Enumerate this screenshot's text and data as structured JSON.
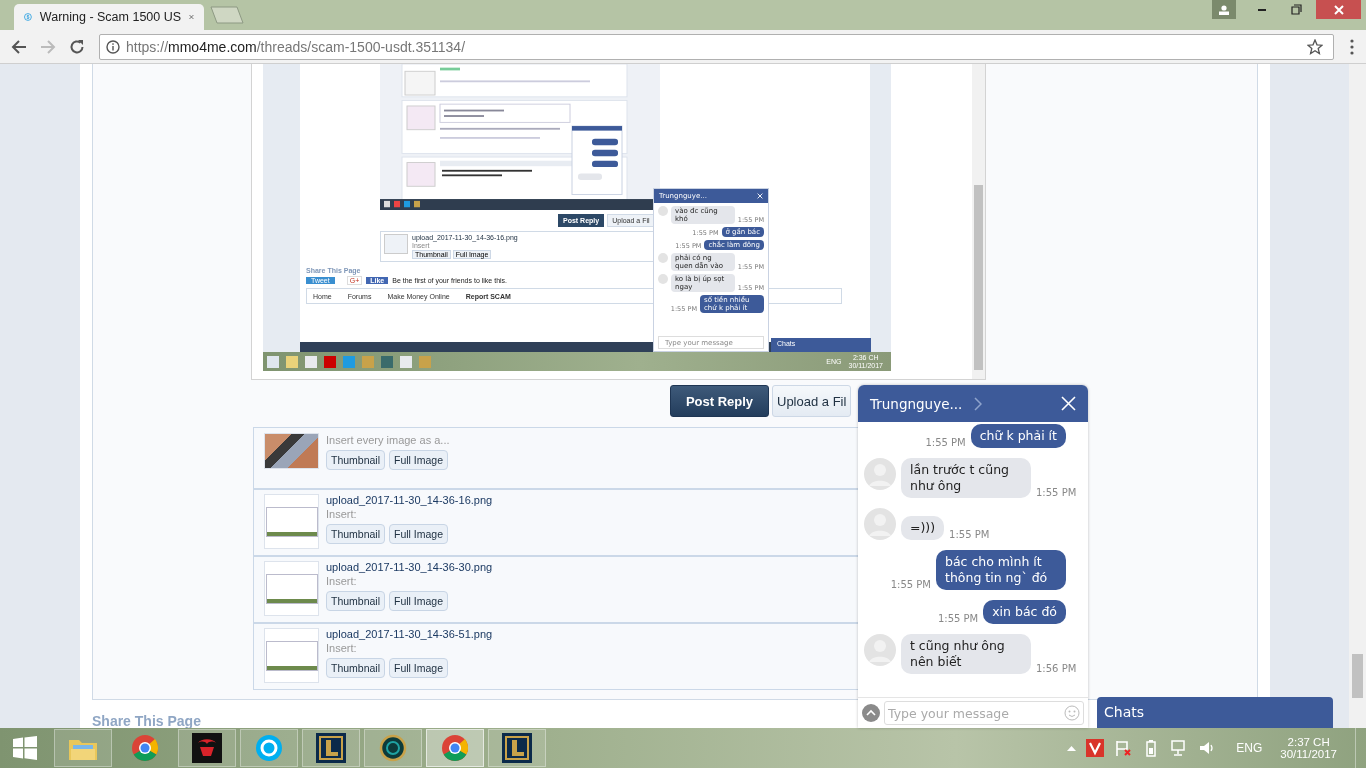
{
  "browser": {
    "tab_title": "Warning - Scam 1500 US",
    "url": "https://mmo4me.com/threads/scam-1500-usdt.351134/"
  },
  "embedded_screenshot": {
    "buttons": [
      "Post Reply",
      "Upload a Fil"
    ],
    "upload": {
      "filename": "upload_2017-11-30_14-36-16.png",
      "insert_label": "Insert",
      "buttons": [
        "Thumbnail",
        "Full Image"
      ]
    },
    "share_title": "Share This Page",
    "tweet": "Tweet",
    "gplus": "G+",
    "like": "Like",
    "like_text": "Be the first of your friends to like this.",
    "breadcrumbs": [
      "Home",
      "Forums",
      "Make Money Online",
      "Report SCAM"
    ],
    "chat": {
      "title": "Trungnguye...",
      "placeholder": "Type your message",
      "messages": [
        {
          "kind": "incoming",
          "text": "vào đc cũng khó",
          "time": "1:55 PM"
        },
        {
          "kind": "outgoing",
          "text": "ở gần bác",
          "time": "1:55 PM"
        },
        {
          "kind": "outgoing",
          "text": "chắc làm đông",
          "time": "1:55 PM"
        },
        {
          "kind": "incoming",
          "text": "phải có ng quen dẫn vào",
          "time": "1:55 PM"
        },
        {
          "kind": "incoming",
          "text": "ko là bị úp sọt ngay",
          "time": "1:55 PM"
        },
        {
          "kind": "outgoing",
          "text": "số tiền nhiều chứ k phải ít",
          "time": "1:55 PM"
        }
      ]
    },
    "chats_label": "Chats",
    "taskbar": {
      "language": "ENG",
      "time": "2:36 CH",
      "date": "30/11/2017"
    }
  },
  "reply_buttons": [
    "Post Reply",
    "Upload a Fil"
  ],
  "attachments": {
    "insert_all": "Insert every image as a...",
    "buttons": [
      "Thumbnail",
      "Full Image"
    ],
    "files": [
      {
        "name": "upload_2017-11-30_14-36-16.png",
        "insert_label": "Insert:",
        "buttons": [
          "Thumbnail",
          "Full Image"
        ]
      },
      {
        "name": "upload_2017-11-30_14-36-30.png",
        "insert_label": "Insert:",
        "buttons": [
          "Thumbnail",
          "Full Image"
        ]
      },
      {
        "name": "upload_2017-11-30_14-36-51.png",
        "insert_label": "Insert:",
        "buttons": [
          "Thumbnail",
          "Full Image"
        ]
      }
    ]
  },
  "share_title": "Share This Page",
  "chat": {
    "title": "Trungnguye...",
    "placeholder": "Type your message",
    "messages": [
      {
        "kind": "outgoing",
        "text": "chữ k phải ít",
        "time": "1:55 PM"
      },
      {
        "kind": "incoming",
        "text": "lần trước t cũng như ông",
        "time": "1:55 PM"
      },
      {
        "kind": "incoming",
        "text": "=)))",
        "time": "1:55 PM"
      },
      {
        "kind": "outgoing",
        "text": "bác cho mình ít thông tin ng` đó",
        "time": "1:55 PM"
      },
      {
        "kind": "outgoing",
        "text": "xin bác đó",
        "time": "1:55 PM"
      },
      {
        "kind": "incoming",
        "text": "t cũng như ông nên biết",
        "time": "1:56 PM"
      }
    ]
  },
  "chats_label": "Chats",
  "taskbar": {
    "language": "ENG",
    "time": "2:37 CH",
    "date": "30/11/2017"
  }
}
